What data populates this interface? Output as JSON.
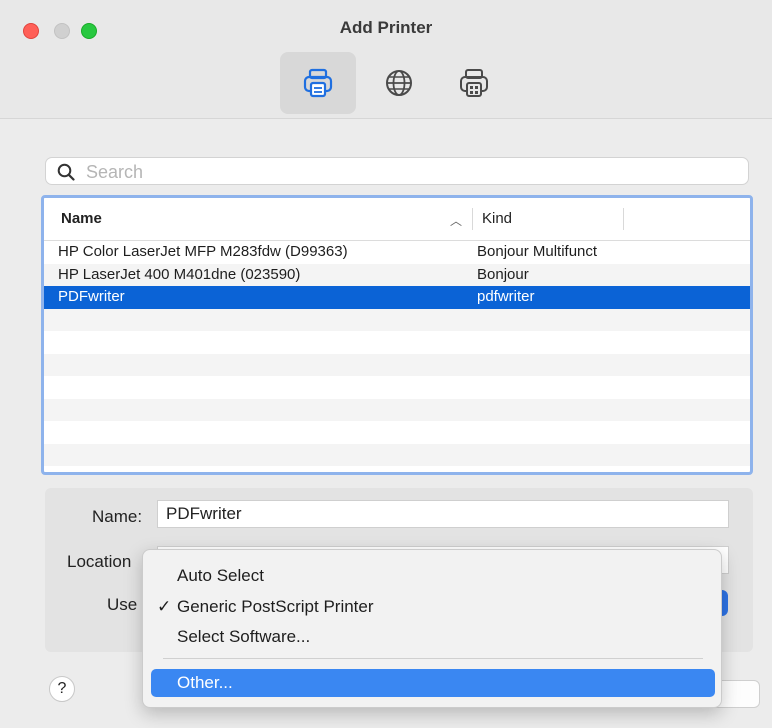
{
  "window": {
    "title": "Add Printer"
  },
  "toolbar": {
    "items": [
      {
        "name": "default-printers",
        "selected": true
      },
      {
        "name": "ip-printers",
        "selected": false
      },
      {
        "name": "windows-printers",
        "selected": false
      }
    ]
  },
  "search": {
    "placeholder": "Search",
    "value": ""
  },
  "table": {
    "columns": [
      "Name",
      "Kind"
    ],
    "sort": "ascending",
    "rows": [
      {
        "name": "HP Color LaserJet MFP M283fdw (D99363)",
        "kind": "Bonjour Multifunct"
      },
      {
        "name": "HP LaserJet 400 M401dne (023590)",
        "kind": "Bonjour"
      },
      {
        "name": "PDFwriter",
        "kind": "pdfwriter",
        "selected": true
      },
      {
        "name": "",
        "kind": ""
      },
      {
        "name": "",
        "kind": ""
      },
      {
        "name": "",
        "kind": ""
      },
      {
        "name": "",
        "kind": ""
      },
      {
        "name": "",
        "kind": ""
      },
      {
        "name": "",
        "kind": ""
      },
      {
        "name": "",
        "kind": ""
      }
    ]
  },
  "form": {
    "name_label": "Name:",
    "name_value": "PDFwriter",
    "location_label": "Location",
    "location_value": "",
    "use_label": "Use"
  },
  "menu": {
    "items": [
      {
        "label": "Auto Select",
        "checked": false,
        "highlighted": false
      },
      {
        "label": "Generic PostScript Printer",
        "checked": true,
        "highlighted": false
      },
      {
        "label": "Select Software...",
        "checked": false,
        "highlighted": false
      },
      {
        "label": "Other...",
        "checked": false,
        "highlighted": true
      }
    ],
    "check_glyph": "✓"
  },
  "help": {
    "label": "?"
  },
  "colors": {
    "selection": "#0b63d6",
    "menu_highlight": "#3a87f2",
    "focus_ring": "#8eb3ec"
  }
}
